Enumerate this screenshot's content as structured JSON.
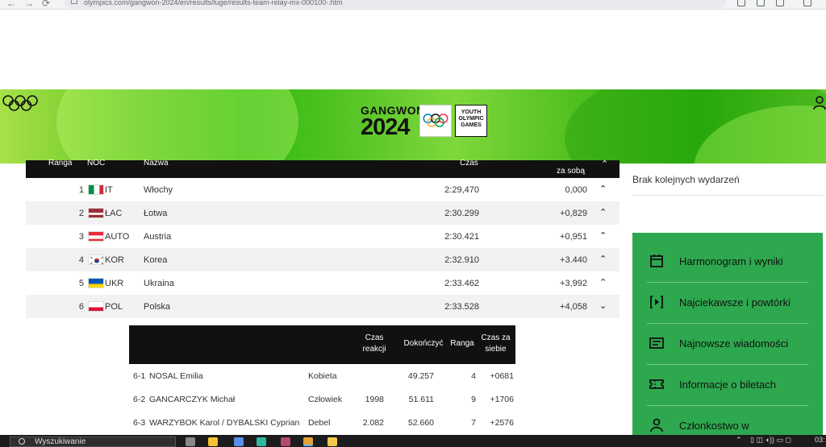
{
  "browser": {
    "url": "olympics.com/gangwon-2024/en/results/luge/results-team-relay-mx-000100-.htm"
  },
  "banner": {
    "logo_line1": "GANGWON",
    "logo_line2": "2024",
    "badge": "YOUTH OLYMPIC GAMES"
  },
  "results": {
    "columns": {
      "rank": "Ranga",
      "noc": "NOC",
      "name": "Nazwa",
      "time": "Czas",
      "behind": "za sobą"
    },
    "rows": [
      {
        "rank": "1",
        "noc": "IT",
        "name": "Włochy",
        "time": "2:29,470",
        "gap": "0,000",
        "chev": "⌃",
        "flag": "it"
      },
      {
        "rank": "2",
        "noc": "ŁAC",
        "name": "Łotwa",
        "time": "2:30.299",
        "gap": "+0,829",
        "chev": "⌃",
        "flag": "lv"
      },
      {
        "rank": "3",
        "noc": "AUTO",
        "name": "Austria",
        "time": "2:30.421",
        "gap": "+0,951",
        "chev": "⌃",
        "flag": "at"
      },
      {
        "rank": "4",
        "noc": "KOR",
        "name": "Korea",
        "time": "2:32.910",
        "gap": "+3.440",
        "chev": "⌃",
        "flag": "kr"
      },
      {
        "rank": "5",
        "noc": "UKR",
        "name": "Ukraina",
        "time": "2:33.462",
        "gap": "+3,992",
        "chev": "⌃",
        "flag": "ua"
      },
      {
        "rank": "6",
        "noc": "POL",
        "name": "Polska",
        "time": "2:33.528",
        "gap": "+4,058",
        "chev": "⌄",
        "flag": "pl"
      }
    ]
  },
  "team_detail": {
    "columns": {
      "reaction": "Czas reakcji",
      "finish": "Dokończyć",
      "rank": "Ranga",
      "own_time": "Czas za siebie"
    },
    "rows": [
      {
        "id": "6-1",
        "athlete": "NOSAL Emilia",
        "event": "Kobieta",
        "reaction": "",
        "finish": "49.257",
        "rank": "4",
        "own": "+0681"
      },
      {
        "id": "6-2",
        "athlete": "GANCARCZYK Michał",
        "event": "Człowiek",
        "reaction": "1998",
        "finish": "51.611",
        "rank": "9",
        "own": "+1706"
      },
      {
        "id": "6-3",
        "athlete": "WARZYBOK Karol / DYBALSKI Cyprian",
        "event": "Debel",
        "reaction": "2.082",
        "finish": "52.660",
        "rank": "7",
        "own": "+2576"
      }
    ]
  },
  "sidebar": {
    "no_events": "Brak kolejnych wydarzeń",
    "items": [
      {
        "label": "Harmonogram i wyniki",
        "icon": "calendar-icon"
      },
      {
        "label": "Najciekawsze i powtórki",
        "icon": "play-icon"
      },
      {
        "label": "Najnowsze wiadomości",
        "icon": "news-icon"
      },
      {
        "label": "Informacje o biletach",
        "icon": "ticket-icon"
      },
      {
        "label": "Członkostwo w",
        "icon": "user-icon"
      }
    ]
  },
  "taskbar": {
    "search_placeholder": "Wyszukiwanie",
    "clock": "03:"
  },
  "colors": {
    "panel_green": "#2ea84e",
    "header_black": "#111111"
  }
}
